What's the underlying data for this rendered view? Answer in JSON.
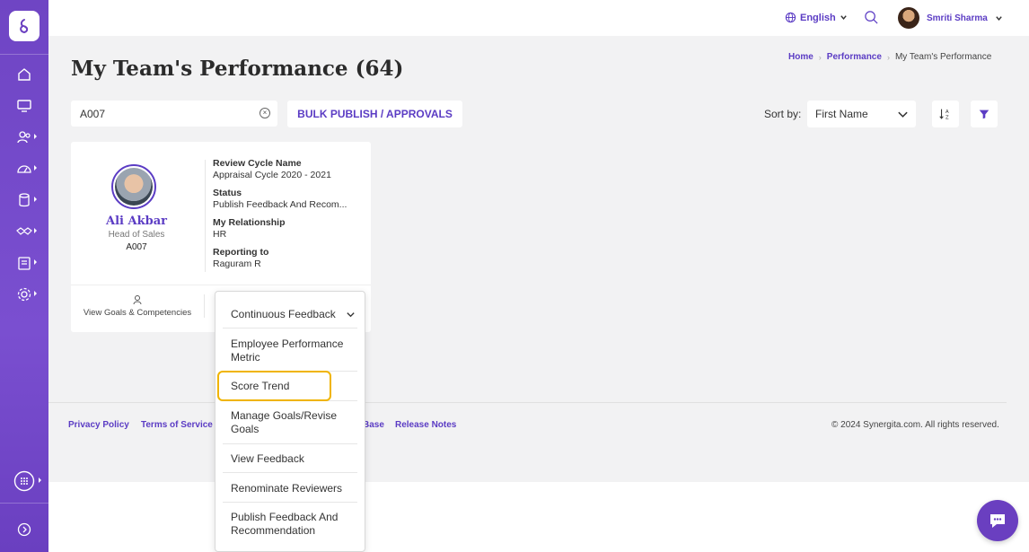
{
  "app": {
    "brand": "Synergita",
    "accent": "#5b3cc4"
  },
  "sidebar": {
    "icons": [
      "logo-icon",
      "home-icon",
      "monitor-icon",
      "team-icon",
      "dashboard-icon",
      "database-icon",
      "handshake-icon",
      "clipboard-icon",
      "settings-icon",
      "apps-grid-icon",
      "expand-icon"
    ]
  },
  "topbar": {
    "language": "English",
    "user_name": "Smriti Sharma"
  },
  "page": {
    "title": "My Team's Performance (64)"
  },
  "breadcrumb": {
    "home": "Home",
    "performance": "Performance",
    "current": "My Team's Performance"
  },
  "search": {
    "value": "A007"
  },
  "toolbar": {
    "bulk_label": "BULK PUBLISH / APPROVALS",
    "sort_label": "Sort by:",
    "sort_value": "First Name"
  },
  "card": {
    "name": "Ali Akbar",
    "role": "Head of Sales",
    "emp_id": "A007",
    "review_cycle_label": "Review Cycle Name",
    "review_cycle_value": "Appraisal Cycle 2020 - 2021",
    "status_label": "Status",
    "status_value": "Publish Feedback And Recom...",
    "relationship_label": "My Relationship",
    "relationship_value": "HR",
    "reporting_label": "Reporting to",
    "reporting_value": "Raguram R",
    "goals_link": "View Goals & Competencies"
  },
  "menu": {
    "head": "Continuous Feedback",
    "items": [
      {
        "label1": "Employee Performance",
        "label2": "Metric"
      },
      {
        "label1": "Score Trend",
        "label2": ""
      },
      {
        "label1": "Manage Goals/Revise",
        "label2": "Goals"
      },
      {
        "label1": "View Feedback",
        "label2": ""
      },
      {
        "label1": "Renominate Reviewers",
        "label2": ""
      },
      {
        "label1": "Publish Feedback And",
        "label2": "Recommendation"
      }
    ]
  },
  "footer": {
    "privacy": "Privacy Policy",
    "terms": "Terms of Service",
    "kb": "Base",
    "release": "Release Notes",
    "copyright": "© 2024 Synergita.com. All rights reserved."
  }
}
